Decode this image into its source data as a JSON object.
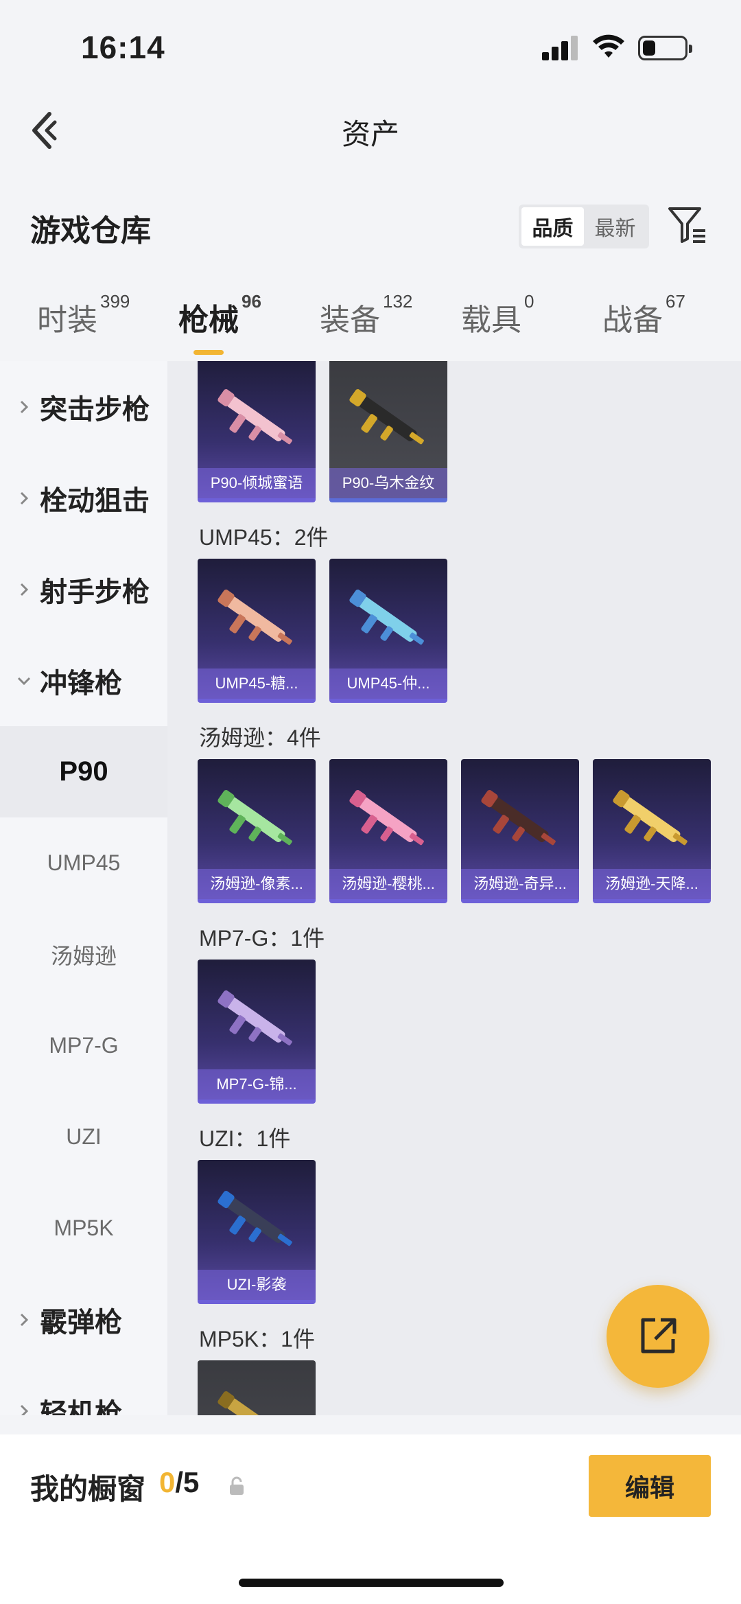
{
  "status_bar": {
    "time": "16:14",
    "battery_level": 0.3
  },
  "nav": {
    "title": "资产"
  },
  "header": {
    "title": "游戏仓库",
    "sort_options": [
      "品质",
      "最新"
    ],
    "active_sort": "品质"
  },
  "tabs": [
    {
      "label": "时装",
      "count": "399"
    },
    {
      "label": "枪械",
      "count": "96"
    },
    {
      "label": "装备",
      "count": "132"
    },
    {
      "label": "载具",
      "count": "0"
    },
    {
      "label": "战备",
      "count": "67"
    }
  ],
  "active_tab": "枪械",
  "sidebar": {
    "categories": [
      "突击步枪",
      "栓动狙击",
      "射手步枪",
      "冲锋枪"
    ],
    "subitems": [
      "P90",
      "UMP45",
      "汤姆逊",
      "MP7-G",
      "UZI",
      "MP5K"
    ],
    "selected": "P90",
    "more_categories": [
      "霰弹枪",
      "轻机枪"
    ]
  },
  "groups": [
    {
      "label": "",
      "items": [
        "P90-倾城蜜语",
        "P90-乌木金纹"
      ]
    },
    {
      "label": "UMP45：2件",
      "items": [
        "UMP45-糖...",
        "UMP45-仲..."
      ]
    },
    {
      "label": "汤姆逊：4件",
      "items": [
        "汤姆逊-像素...",
        "汤姆逊-樱桃...",
        "汤姆逊-奇异...",
        "汤姆逊-天降..."
      ]
    },
    {
      "label": "MP7-G：1件",
      "items": [
        "MP7-G-锦..."
      ]
    },
    {
      "label": "UZI：1件",
      "items": [
        "UZI-影袭"
      ]
    },
    {
      "label": "MP5K：1件",
      "items": [
        ""
      ]
    }
  ],
  "bottom": {
    "showcase_label": "我的橱窗",
    "current": "0",
    "total": "/5",
    "edit_label": "编辑"
  },
  "colors": {
    "accent": "#f4b73a",
    "card_purple": "#37306e"
  }
}
